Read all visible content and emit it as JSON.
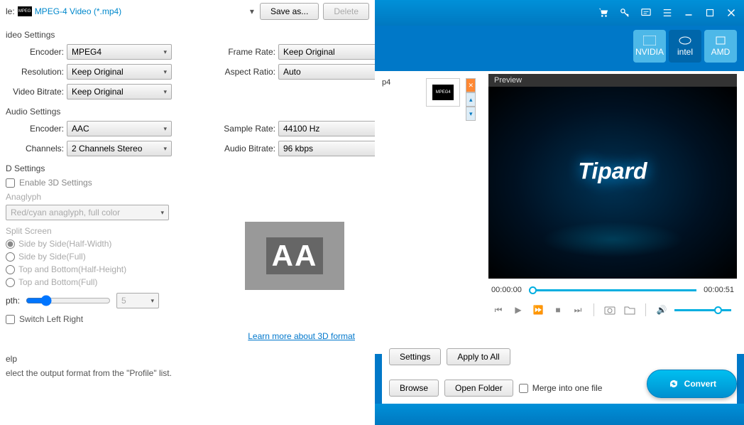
{
  "profile": {
    "label": "le:",
    "name": "MPEG-4 Video (*.mp4)",
    "save_as": "Save as...",
    "delete": "Delete"
  },
  "video": {
    "title": "ideo Settings",
    "encoder_lbl": "Encoder:",
    "encoder": "MPEG4",
    "frame_rate_lbl": "Frame Rate:",
    "frame_rate": "Keep Original",
    "resolution_lbl": "Resolution:",
    "resolution": "Keep Original",
    "aspect_lbl": "Aspect Ratio:",
    "aspect": "Auto",
    "bitrate_lbl": "Video Bitrate:",
    "bitrate": "Keep Original"
  },
  "audio": {
    "title": "Audio Settings",
    "encoder_lbl": "Encoder:",
    "encoder": "AAC",
    "sample_lbl": "Sample Rate:",
    "sample": "44100 Hz",
    "channels_lbl": "Channels:",
    "channels": "2 Channels Stereo",
    "bitrate_lbl": "Audio Bitrate:",
    "bitrate": "96 kbps"
  },
  "three_d": {
    "title": "D Settings",
    "enable": "Enable 3D Settings",
    "anaglyph_lbl": "Anaglyph",
    "anaglyph": "Red/cyan anaglyph, full color",
    "split_lbl": "Split Screen",
    "opt1": "Side by Side(Half-Width)",
    "opt2": "Side by Side(Full)",
    "opt3": "Top and Bottom(Half-Height)",
    "opt4": "Top and Bottom(Full)",
    "depth_lbl": "pth:",
    "depth_val": "5",
    "switch": "Switch Left Right",
    "learn_more": "Learn more about 3D format",
    "aa": "AA"
  },
  "help": {
    "title": "elp",
    "text": "elect the output format from the \"Profile\" list."
  },
  "gpu": {
    "nvidia": "NVIDIA",
    "intel": "intel",
    "amd": "AMD"
  },
  "file": {
    "ext": "p4"
  },
  "preview": {
    "label": "Preview",
    "brand": "Tipard",
    "t0": "00:00:00",
    "t1": "00:00:51"
  },
  "actions": {
    "settings": "Settings",
    "apply_all": "Apply to All",
    "browse": "Browse",
    "open_folder": "Open Folder",
    "merge": "Merge into one file",
    "convert": "Convert"
  }
}
